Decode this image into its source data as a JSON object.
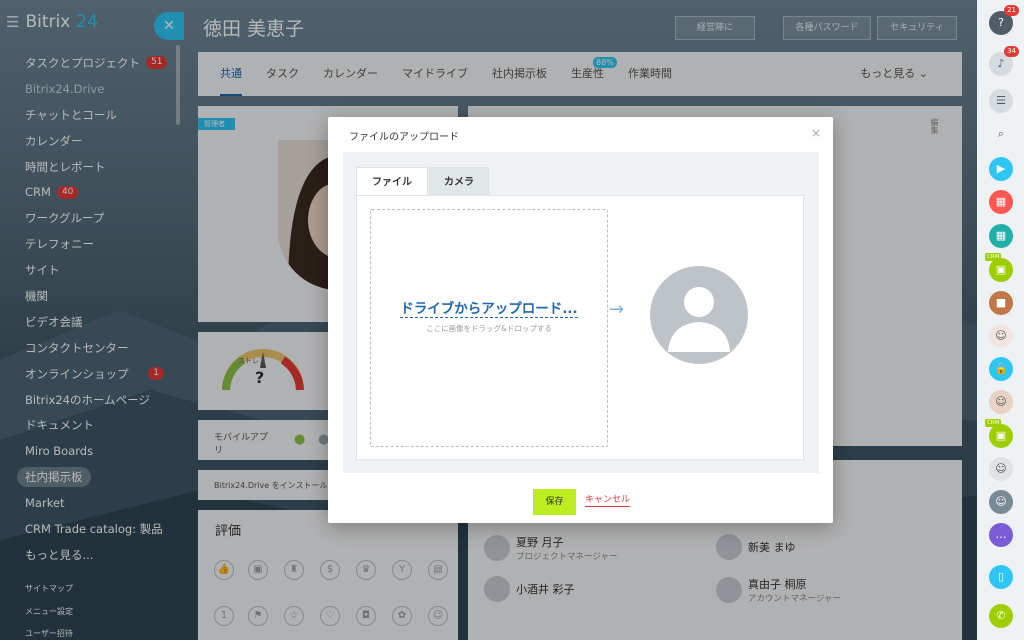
{
  "app": {
    "logo": "Bitrix",
    "logo_suffix": "24"
  },
  "sidebar": {
    "items": [
      {
        "label": "タスクとプロジェクト",
        "count": "51"
      },
      {
        "label": "Bitrix24.Drive"
      },
      {
        "label": "チャットとコール"
      },
      {
        "label": "カレンダー"
      },
      {
        "label": "時間とレポート"
      },
      {
        "label": "CRM",
        "count": "40"
      },
      {
        "label": "ワークグループ"
      },
      {
        "label": "テレフォニー"
      },
      {
        "label": "サイト"
      },
      {
        "label": "機関"
      },
      {
        "label": "ビデオ会議"
      },
      {
        "label": "コンタクトセンター"
      },
      {
        "label": "オンラインショップ",
        "count": "1"
      },
      {
        "label": "Bitrix24のホームページ"
      },
      {
        "label": "ドキュメント"
      },
      {
        "label": "Miro Boards"
      },
      {
        "label": "社内掲示板"
      },
      {
        "label": "Market"
      },
      {
        "label": "CRM Trade catalog: 製品"
      },
      {
        "label": "もっと見る..."
      }
    ],
    "footer": [
      "サイトマップ",
      "メニュー設定",
      "ユーザー招待"
    ]
  },
  "profile": {
    "name": "徳田 美恵子",
    "top_buttons": [
      "経営陣に",
      "各種パスワード",
      "セキュリティ"
    ],
    "tabs": [
      "共通",
      "タスク",
      "カレンダー",
      "マイドライブ",
      "社内掲示板",
      "生産性",
      "作業時間"
    ],
    "productivity_badge": "88%",
    "more": "もっと見る",
    "admin_badge": "管理者",
    "edit": "編集",
    "stress_label": "ストレス",
    "stress_value": "?",
    "mobile_app": "モバイルアプリ",
    "drive_install": "Bitrix24.Drive をインストール",
    "rating_title": "評価",
    "employees": [
      {
        "name": "夏野 月子",
        "role": "プロジェクトマネージャー"
      },
      {
        "name": "新美 まゆ",
        "role": ""
      },
      {
        "name": "小酒井 彩子",
        "role": ""
      },
      {
        "name": "真由子 桐原",
        "role": "アカウントマネージャー"
      }
    ]
  },
  "rail": {
    "help_count": "21",
    "notify_count": "34",
    "crm": "CRM"
  },
  "dialog": {
    "title": "ファイルのアップロード",
    "close": "×",
    "tabs": [
      "ファイル",
      "カメラ"
    ],
    "drop_main": "ドライブからアップロード...",
    "drop_sub": "ここに画像をドラッグ&ドロップする",
    "arrow": "→",
    "save": "保存",
    "cancel": "キャンセル"
  },
  "colors": {
    "accent": "#2fc6f6",
    "save": "#bbed21",
    "link": "#2067b0",
    "badge": "#e53935"
  }
}
